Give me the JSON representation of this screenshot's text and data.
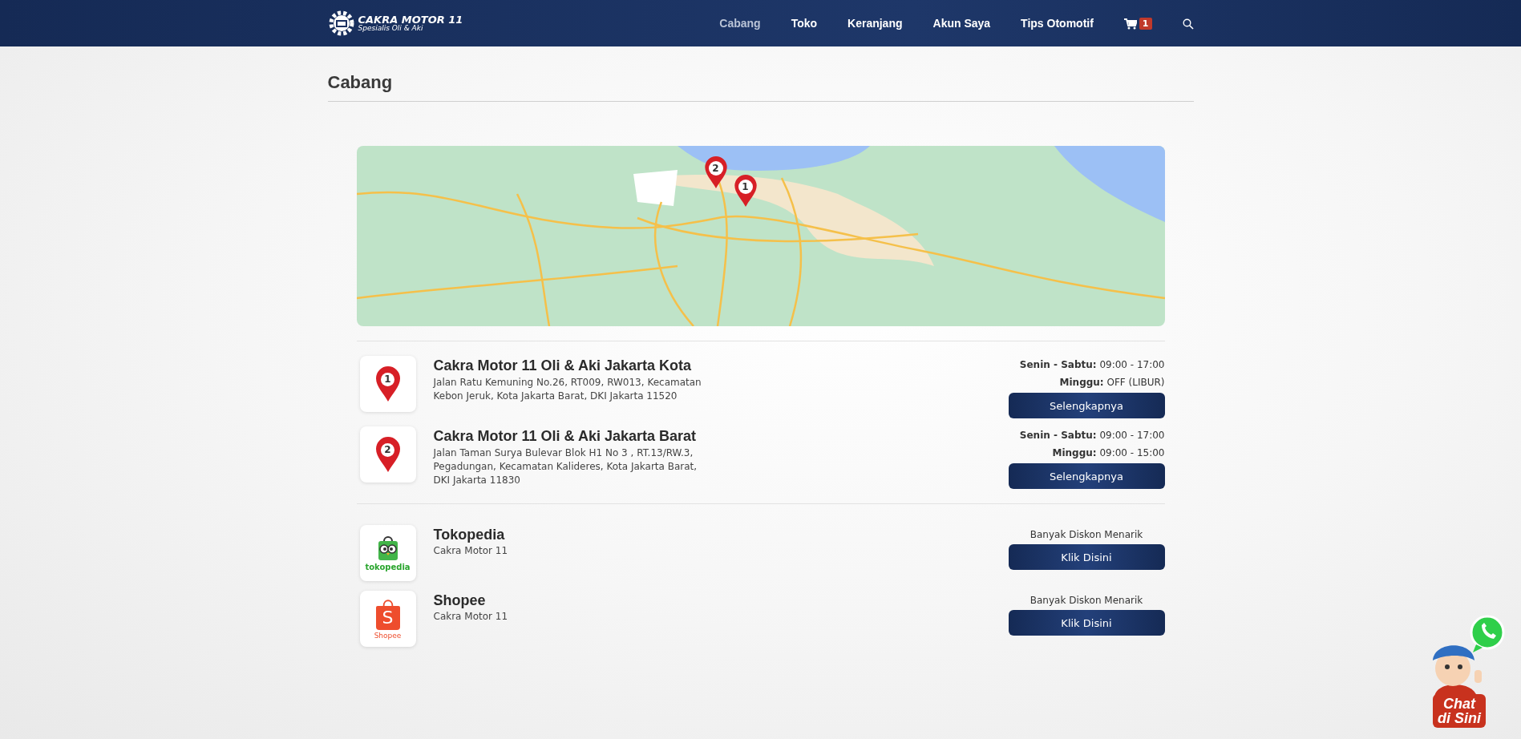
{
  "header": {
    "logo": {
      "title": "CAKRA MOTOR 11",
      "subtitle": "Spesialis Oli & Aki"
    },
    "nav": [
      {
        "label": "Cabang",
        "selected": true
      },
      {
        "label": "Toko",
        "selected": false
      },
      {
        "label": "Keranjang",
        "selected": false
      },
      {
        "label": "Akun Saya",
        "selected": false
      },
      {
        "label": "Tips Otomotif",
        "selected": false
      }
    ],
    "cart": {
      "count": "1"
    }
  },
  "page": {
    "title": "Cabang"
  },
  "map": {
    "pins": [
      {
        "label": "2"
      },
      {
        "label": "1"
      }
    ]
  },
  "branches": [
    {
      "pin": "1",
      "name": "Cakra Motor 11 Oli & Aki Jakarta Kota",
      "address": "Jalan Ratu Kemuning No.26, RT009, RW013, Kecamatan Kebon Jeruk, Kota Jakarta Barat, DKI Jakarta 11520",
      "hours": [
        {
          "days": "Senin - Sabtu:",
          "time": "09:00 - 17:00"
        },
        {
          "days": "Minggu:",
          "time": "OFF (LIBUR)"
        }
      ],
      "button": "Selengkapnya"
    },
    {
      "pin": "2",
      "name": "Cakra Motor 11 Oli & Aki Jakarta Barat",
      "address": "Jalan Taman Surya Bulevar Blok H1 No 3 , RT.13/RW.3, Pegadungan, Kecamatan Kalideres, Kota Jakarta Barat, DKI Jakarta 11830",
      "hours": [
        {
          "days": "Senin - Sabtu:",
          "time": "09:00 - 17:00"
        },
        {
          "days": "Minggu:",
          "time": "09:00 - 15:00"
        }
      ],
      "button": "Selengkapnya"
    }
  ],
  "stores": [
    {
      "kind": "tokopedia",
      "logo_text": "tokopedia",
      "name": "Tokopedia",
      "subtitle": "Cakra Motor 11",
      "tagline": "Banyak Diskon Menarik",
      "button": "Klik Disini"
    },
    {
      "kind": "shopee",
      "logo_letter": "S",
      "logo_text": "Shopee",
      "name": "Shopee",
      "subtitle": "Cakra Motor 11",
      "tagline": "Banyak Diskon Menarik",
      "button": "Klik Disini"
    }
  ],
  "chat_widget": {
    "lines": [
      "Chat",
      "di Sini"
    ]
  }
}
